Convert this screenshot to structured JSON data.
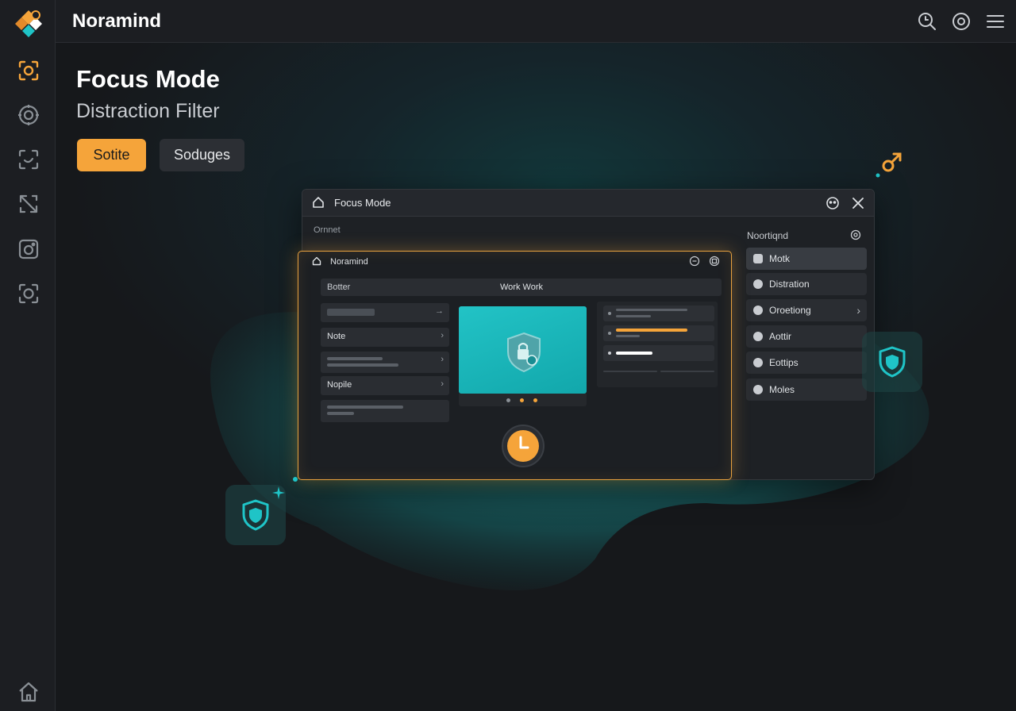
{
  "app": {
    "title": "Noramind"
  },
  "colors": {
    "accent": "#f5a43a",
    "teal": "#1fc4c7",
    "background": "#16181b",
    "panel": "#1c1e22"
  },
  "sidebar": {
    "icons": [
      "focus-icon",
      "target-icon",
      "scan-icon",
      "block-icon",
      "camera-icon",
      "face-scan-icon"
    ],
    "bottom_icon": "home-icon"
  },
  "topbar": {
    "icons": [
      "search-icon",
      "settings-icon",
      "menu-icon"
    ]
  },
  "page": {
    "title": "Focus Mode",
    "subtitle": "Distraction Filter",
    "primary_button": "Sotite",
    "secondary_button": "Soduges"
  },
  "window": {
    "title": "Focus Mode",
    "label": "Ornnet",
    "panel_title": "Noortiqnd",
    "panel_items": [
      {
        "label": "Motk",
        "active": true,
        "chevron": false
      },
      {
        "label": "Distration",
        "active": false,
        "chevron": false
      },
      {
        "label": "Oroetiong",
        "active": false,
        "chevron": true
      },
      {
        "label": "Aottir",
        "active": false,
        "chevron": false
      },
      {
        "label": "Eottips",
        "active": false,
        "chevron": false
      },
      {
        "label": "Moles",
        "active": false,
        "chevron": false
      }
    ]
  },
  "inner_window": {
    "title": "Noramind",
    "tab_left": "Botter",
    "tab_center": "Work Work",
    "list": [
      {
        "label": ""
      },
      {
        "label": "Note"
      },
      {
        "label": ""
      },
      {
        "label": "Nopile"
      },
      {
        "label": ""
      }
    ],
    "timer_icon": "clock-icon",
    "preview_icon": "shield-lock-icon"
  }
}
